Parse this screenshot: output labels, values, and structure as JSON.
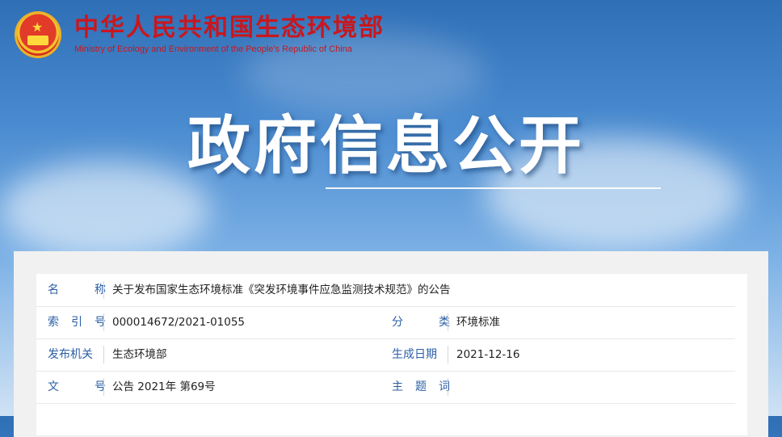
{
  "header": {
    "title_cn": "中华人民共和国生态环境部",
    "title_en": "Ministry of Ecology and Environment of the People's Republic of China",
    "emblem_icon": "national-emblem-icon"
  },
  "hero": {
    "title": "政府信息公开"
  },
  "info": {
    "name_label": "名 称",
    "name_value": "关于发布国家生态环境标准《突发环境事件应急监测技术规范》的公告",
    "index_label": "索 引 号",
    "index_value": "000014672/2021-01055",
    "category_label": "分 类",
    "category_value": "环境标准",
    "issuer_label": "发布机关",
    "issuer_value": "生态环境部",
    "date_label": "生成日期",
    "date_value": "2021-12-16",
    "docno_label": "文 号",
    "docno_value": "公告 2021年 第69号",
    "subject_label": "主 题 词",
    "subject_value": ""
  },
  "colors": {
    "accent": "#c8171e",
    "label": "#2b5fa6"
  }
}
